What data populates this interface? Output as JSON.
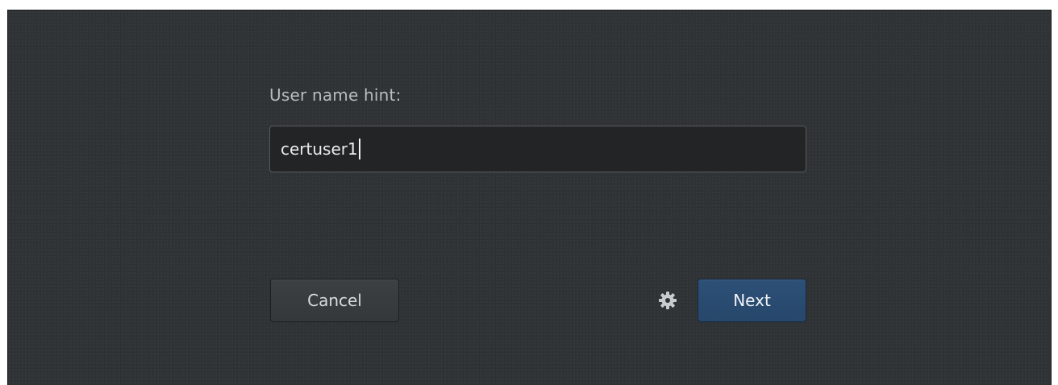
{
  "dialog": {
    "hint_label": "User name hint:",
    "input_value": "certuser1"
  },
  "actions": {
    "cancel_label": "Cancel",
    "next_label": "Next",
    "settings_icon": "gear-icon"
  },
  "colors": {
    "background": "#2f3335",
    "input_background": "#222425",
    "next_button": "#2b4c72"
  }
}
